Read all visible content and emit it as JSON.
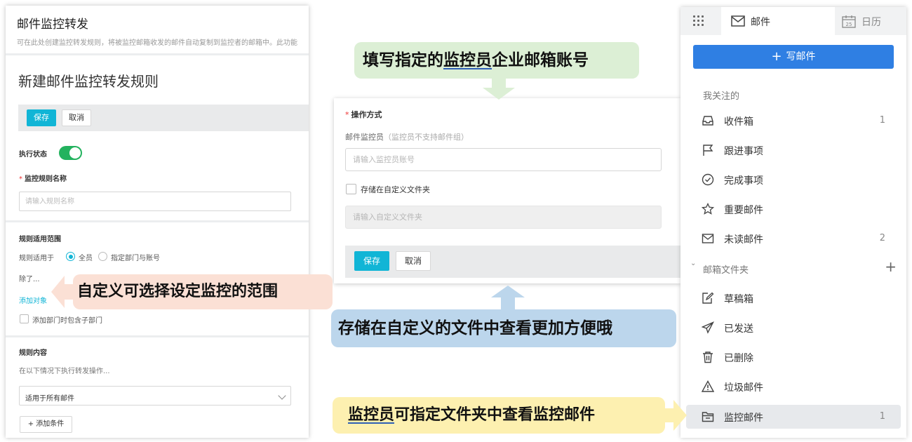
{
  "left_panel": {
    "title": "邮件监控转发",
    "description": "可在此处创建监控转发规则，将被监控邮箱收发的邮件自动复制到监控者的邮箱中。此功能",
    "form_title": "新建邮件监控转发规则",
    "save_label": "保存",
    "cancel_label": "取消",
    "status_label": "执行状态",
    "status_on": true,
    "rule_name_label": "监控规则名称",
    "rule_name_placeholder": "请输入规则名称",
    "scope_title": "规则适用范围",
    "scope_applies_label": "规则适用于",
    "scope_option_all": "全员",
    "scope_option_specific": "指定部门与账号",
    "scope_selected": "全员",
    "except_label": "除了...",
    "add_object_link": "添加对象",
    "include_subdept_label": "添加部门时包含子部门",
    "content_title": "规则内容",
    "content_desc": "在以下情况下执行转发操作...",
    "condition_select_value": "适用于所有邮件",
    "add_condition_label": "+ 添加条件"
  },
  "middle_panel": {
    "operation_label": "操作方式",
    "monitor_label": "邮件监控员",
    "monitor_note": "（监控员不支持邮件组）",
    "monitor_placeholder": "请输入监控员账号",
    "store_folder_label": "存储在自定义文件夹",
    "folder_placeholder": "请输入自定义文件夹",
    "save_label": "保存",
    "cancel_label": "取消"
  },
  "right_panel": {
    "tab_mail": "邮件",
    "tab_calendar": "日历",
    "calendar_day": "25",
    "compose_label": "写邮件",
    "section_following": "我关注的",
    "section_folders": "邮箱文件夹",
    "items_following": [
      {
        "label": "收件箱",
        "count": "1",
        "icon": "inbox-icon"
      },
      {
        "label": "跟进事项",
        "count": "",
        "icon": "flag-icon"
      },
      {
        "label": "完成事项",
        "count": "",
        "icon": "check-circle-icon"
      },
      {
        "label": "重要邮件",
        "count": "",
        "icon": "star-icon"
      },
      {
        "label": "未读邮件",
        "count": "2",
        "icon": "envelope-icon"
      }
    ],
    "items_folders": [
      {
        "label": "草稿箱",
        "count": "",
        "icon": "draft-icon"
      },
      {
        "label": "已发送",
        "count": "",
        "icon": "send-icon"
      },
      {
        "label": "已删除",
        "count": "",
        "icon": "trash-icon"
      },
      {
        "label": "垃圾邮件",
        "count": "",
        "icon": "warning-icon"
      },
      {
        "label": "监控邮件",
        "count": "1",
        "icon": "folder-icon"
      }
    ]
  },
  "callouts": {
    "green_pre": "填写指定的",
    "green_underlined": "监控员",
    "green_post": "企业邮箱账号",
    "orange": "自定义可选择设定监控的范围",
    "blue": "存储在自定义的文件中查看更加方便哦",
    "yellow_underlined": "监控员",
    "yellow_post": "可指定文件夹中查看监控邮件"
  },
  "colors": {
    "primary_button": "#11b5d6",
    "toggle_on": "#23b25e",
    "compose_button": "#2f7fe3",
    "callout_green": "#dcefd5",
    "callout_orange": "#fbe0d5",
    "callout_blue": "#bcd6ec",
    "callout_yellow": "#fdf0b0"
  }
}
